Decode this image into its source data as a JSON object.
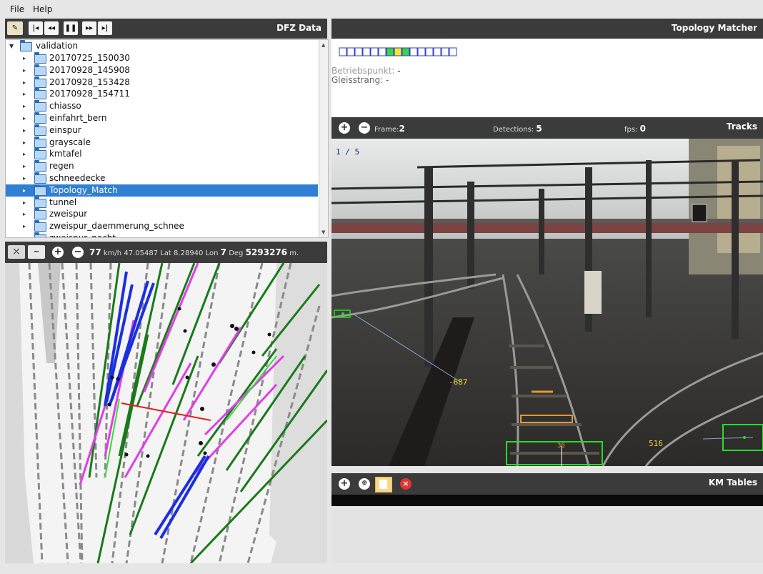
{
  "menubar": {
    "file": "File",
    "help": "Help"
  },
  "dfz": {
    "title": "DFZ Data",
    "controls": [
      "K",
      "«",
      "II",
      "»",
      "H"
    ],
    "tree": {
      "root": "validation",
      "items": [
        "20170725_150030",
        "20170928_145908",
        "20170928_153428",
        "20170928_154711",
        "chiasso",
        "einfahrt_bern",
        "einspur",
        "grayscale",
        "kmtafel",
        "regen",
        "schneedecke",
        "Topology_Match",
        "tunnel",
        "zweispur",
        "zweispur_daemmerung_schnee",
        "zweispur_nacht"
      ],
      "selected": "Topology_Match"
    }
  },
  "topology": {
    "title": "Topology Matcher",
    "betriebspunkt_label": "Betriebspunkt:",
    "betriebspunkt_value": "-",
    "gleisstrang_label": "Gleisstrang:",
    "gleisstrang_value": "-",
    "cells": [
      "empty",
      "empty",
      "empty",
      "empty",
      "empty",
      "empty",
      "green",
      "yellow",
      "green",
      "empty",
      "empty",
      "empty",
      "empty",
      "empty",
      "empty"
    ]
  },
  "map_bar": {
    "speed": "77",
    "speed_unit": "km/h",
    "lat": "47.05487",
    "lat_label": "Lat",
    "lon": "8.28940",
    "lon_label": "Lon",
    "deg": "7",
    "deg_label": "Deg",
    "distance": "5293276",
    "distance_unit": "m."
  },
  "cam_bar": {
    "frame_label": "Frame:",
    "frame_value": "2",
    "detections_label": "Detections:",
    "detections_value": "5",
    "fps_label": "fps:",
    "fps_value": "0",
    "title": "Tracks"
  },
  "camera": {
    "overlay_counter": "1 / 5",
    "label_left": "-687",
    "label_bottom": "516",
    "label_small": "36"
  },
  "km_tables": {
    "title": "KM Tables"
  },
  "colors": {
    "toolbar": "#3b3b3b",
    "selection": "#2f7fd3",
    "track_green": "#1a7a1a",
    "track_magenta": "#e23ce8",
    "track_blue": "#1b2fe0",
    "detection_green": "#23e023",
    "detection_orange": "#e8962a"
  }
}
